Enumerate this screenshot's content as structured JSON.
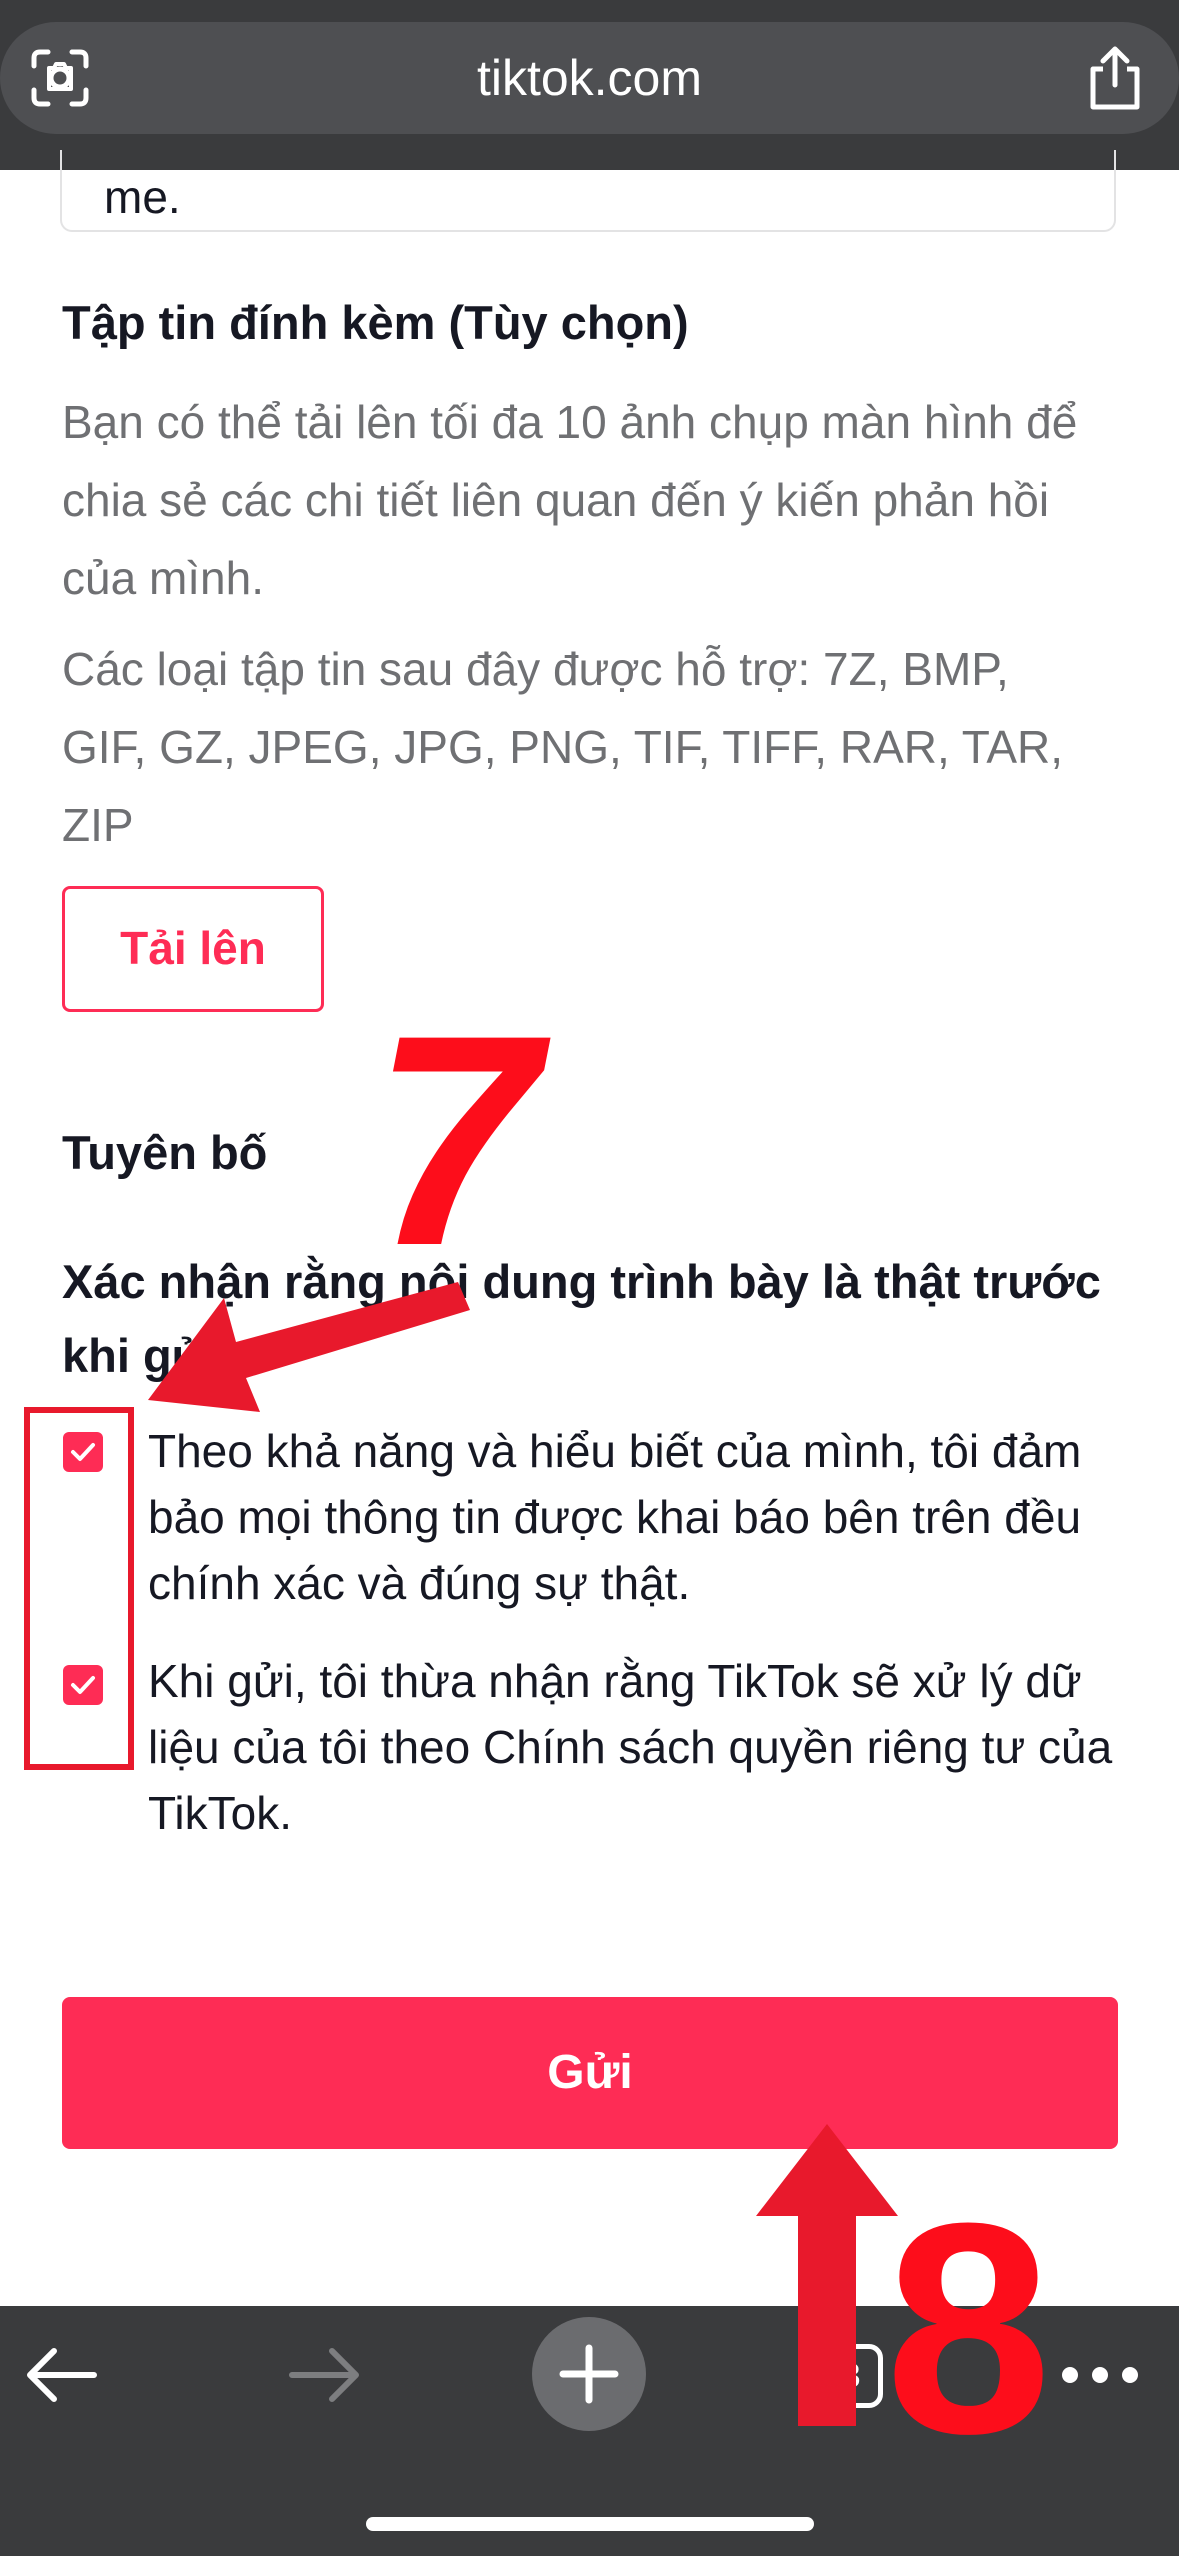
{
  "browser": {
    "url": "tiktok.com",
    "tab_count": "3",
    "icons": [
      "scan-icon",
      "share-icon",
      "back-arrow-icon",
      "forward-arrow-icon",
      "new-tab-plus-icon",
      "tabs-icon",
      "more-icon"
    ]
  },
  "form": {
    "description_tail": "me.",
    "attachments": {
      "title": "Tập tin đính kèm (Tùy chọn)",
      "desc": "Bạn có thể tải lên tối đa 10 ảnh chụp màn hình để chia sẻ các chi tiết liên quan đến ý kiến phản hồi của mình.",
      "types": "Các loại tập tin sau đây được hỗ trợ: 7Z, BMP, GIF, GZ, JPEG, JPG, PNG, TIF, TIFF, RAR, TAR, ZIP",
      "upload_label": "Tải lên"
    },
    "declaration": {
      "title": "Tuyên bố",
      "confirm_title": "Xác nhận rằng nội dung trình bày là thật trước khi gửi",
      "checkbox1": "Theo khả năng và hiểu biết của mình, tôi đảm bảo mọi thông tin được khai báo bên trên đều chính xác và đúng sự thật.",
      "checkbox2": "Khi gửi, tôi thừa nhận rằng TikTok sẽ xử lý dữ liệu của tôi theo Chính sách quyền riêng tư của TikTok.",
      "checkbox1_checked": true,
      "checkbox2_checked": true
    },
    "submit_label": "Gửi"
  },
  "annotations": {
    "step7": "7",
    "step8": "8",
    "color": "#fd0d1b"
  },
  "colors": {
    "accent": "#fe2c55",
    "browser_bar": "#3a3b3d"
  }
}
